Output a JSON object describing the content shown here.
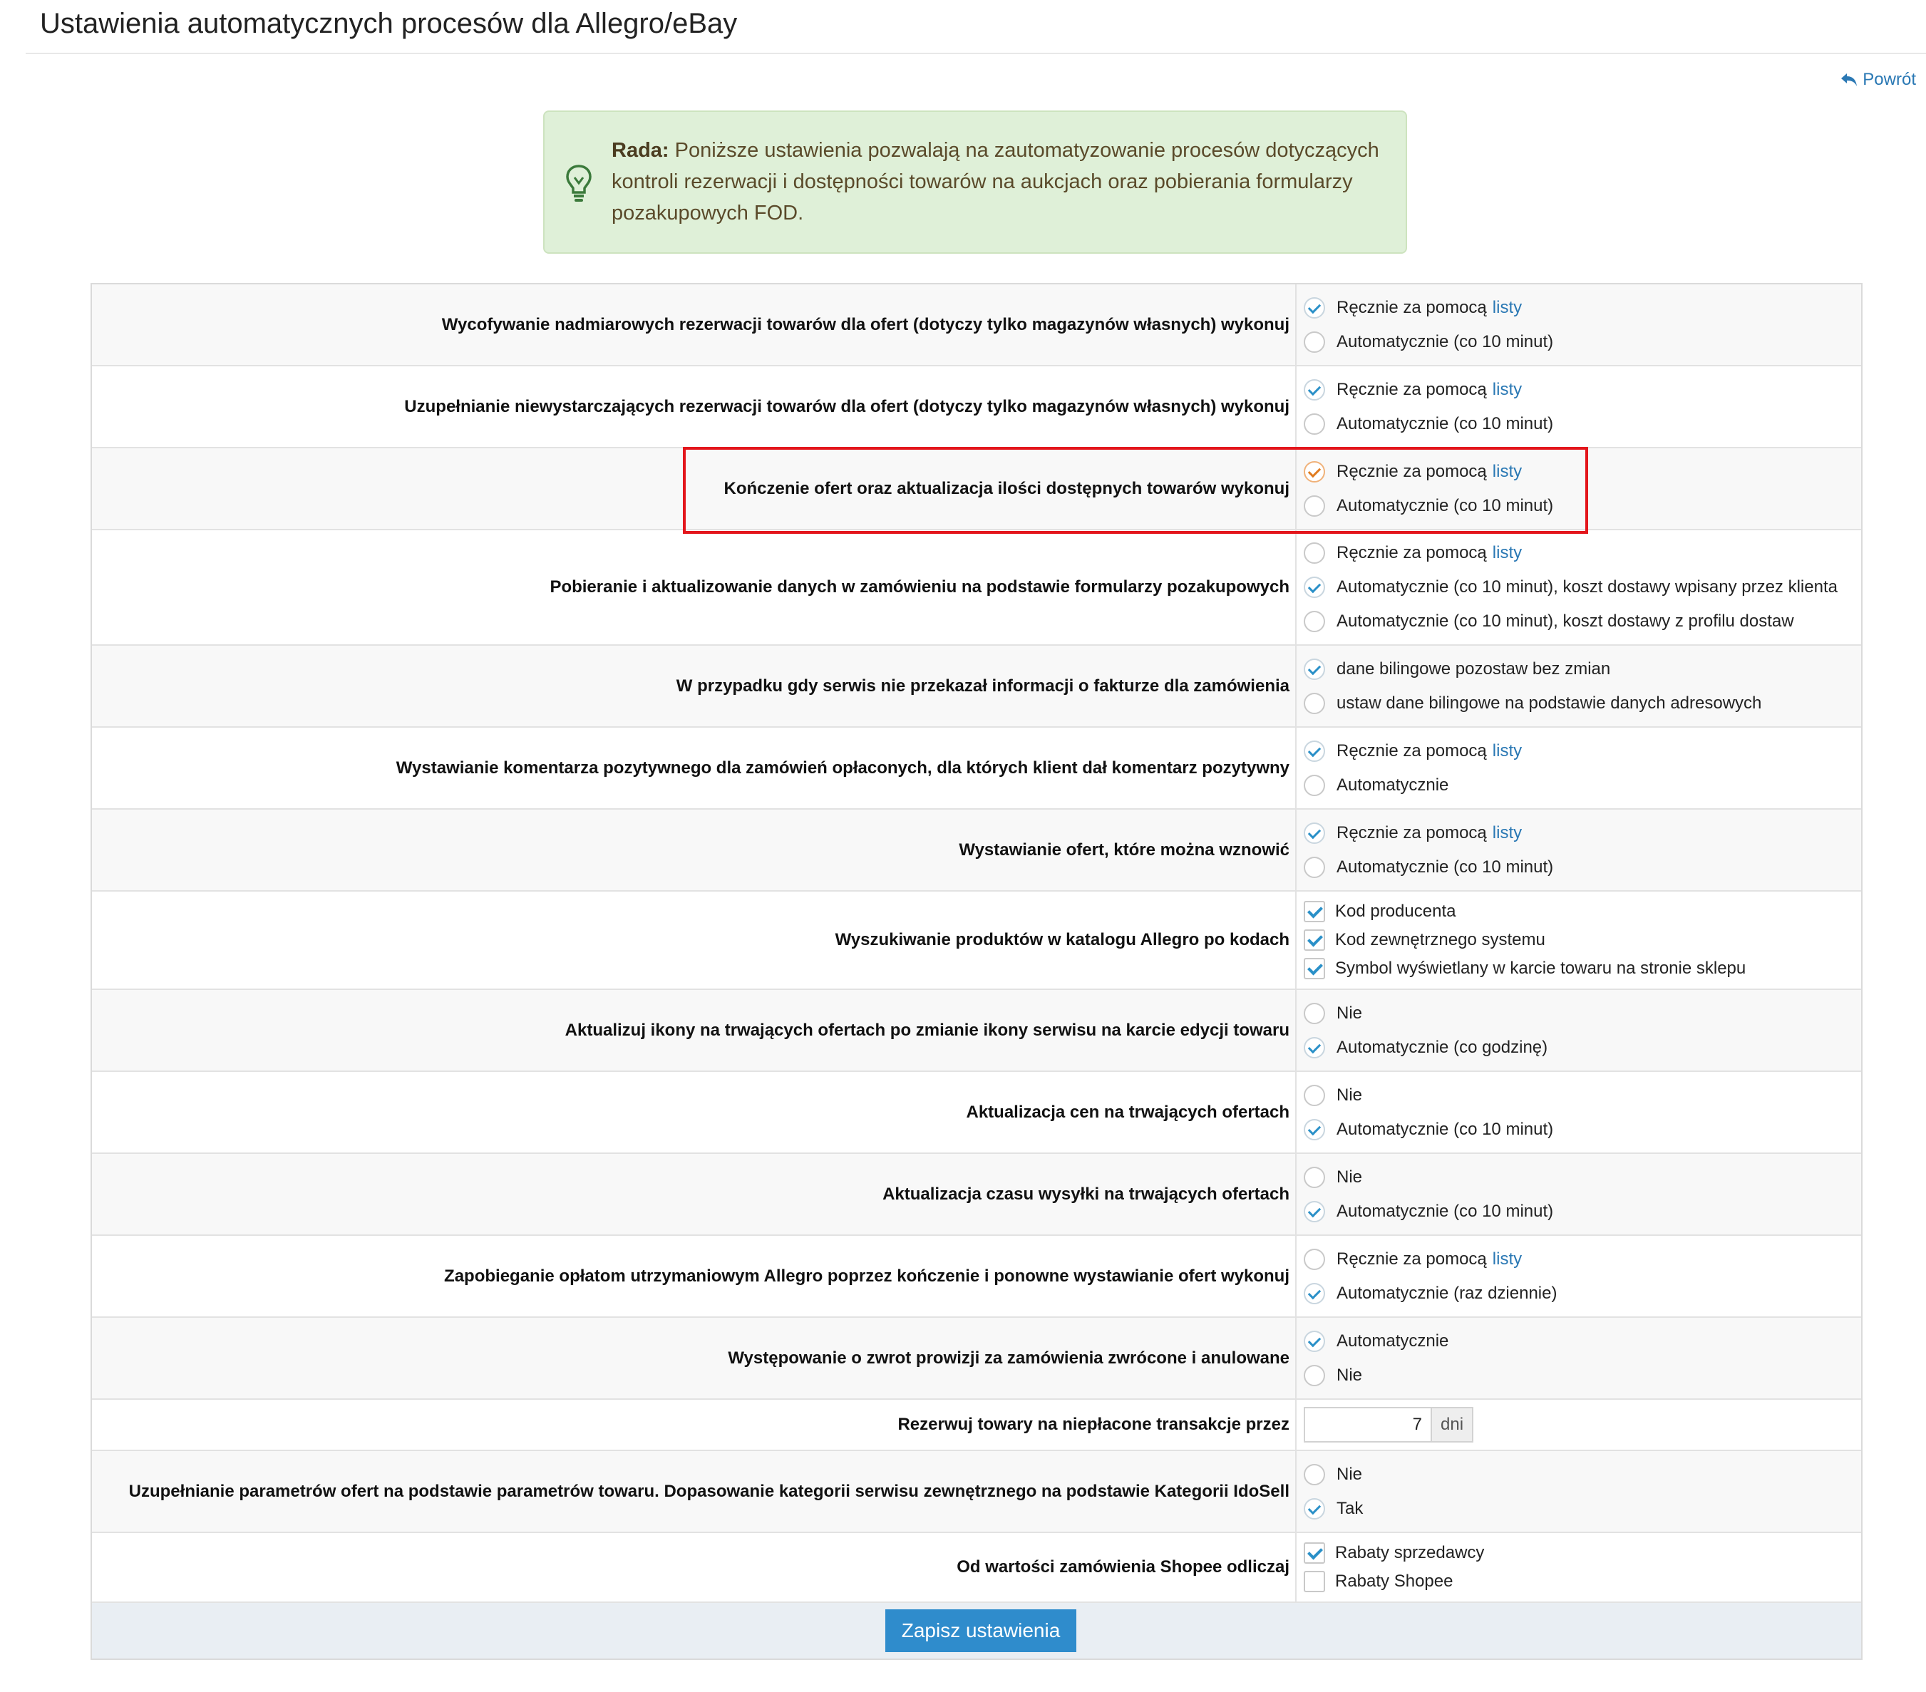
{
  "header": {
    "title": "Ustawienia automatycznych procesów dla Allegro/eBay",
    "back_label": "Powrót"
  },
  "tip": {
    "prefix": "Rada:",
    "text": " Poniższe ustawienia pozwalają na zautomatyzowanie procesów dotyczących kontroli rezerwacji i dostępności towarów na aukcjach oraz pobierania formularzy pozakupowych FOD."
  },
  "settings": [
    {
      "label": "Wycofywanie nadmiarowych rezerwacji towarów dla ofert (dotyczy tylko magazynów własnych) wykonuj",
      "options": [
        {
          "text": "Ręcznie za pomocą",
          "link": "listy",
          "checked": true
        },
        {
          "text": "Automatycznie (co 10 minut)",
          "checked": false
        }
      ]
    },
    {
      "label": "Uzupełnianie niewystarczających rezerwacji towarów dla ofert (dotyczy tylko magazynów własnych) wykonuj",
      "options": [
        {
          "text": "Ręcznie za pomocą",
          "link": "listy",
          "checked": true
        },
        {
          "text": "Automatycznie (co 10 minut)",
          "checked": false
        }
      ]
    },
    {
      "label": "Kończenie ofert oraz aktualizacja ilości dostępnych towarów wykonuj",
      "options": [
        {
          "text": "Ręcznie za pomocą",
          "link": "listy",
          "checked": true
        },
        {
          "text": "Automatycznie (co 10 minut)",
          "checked": false
        }
      ]
    },
    {
      "label": "Pobieranie i aktualizowanie danych w zamówieniu na podstawie formularzy pozakupowych",
      "options": [
        {
          "text": "Ręcznie za pomocą",
          "link": "listy",
          "checked": false
        },
        {
          "text": "Automatycznie (co 10 minut), koszt dostawy wpisany przez klienta",
          "checked": true
        },
        {
          "text": "Automatycznie (co 10 minut), koszt dostawy z profilu dostaw",
          "checked": false
        }
      ]
    },
    {
      "label": "W przypadku gdy serwis nie przekazał informacji o fakturze dla zamówienia",
      "options": [
        {
          "text": "dane bilingowe pozostaw bez zmian",
          "checked": true
        },
        {
          "text": "ustaw dane bilingowe na podstawie danych adresowych",
          "checked": false
        }
      ]
    },
    {
      "label": "Wystawianie komentarza pozytywnego dla zamówień opłaconych, dla których klient dał komentarz pozytywny",
      "options": [
        {
          "text": "Ręcznie za pomocą",
          "link": "listy",
          "checked": true
        },
        {
          "text": "Automatycznie",
          "checked": false
        }
      ]
    },
    {
      "label": "Wystawianie ofert, które można wznowić",
      "options": [
        {
          "text": "Ręcznie za pomocą",
          "link": "listy",
          "checked": true
        },
        {
          "text": "Automatycznie (co 10 minut)",
          "checked": false
        }
      ]
    },
    {
      "label": "Wyszukiwanie produktów w katalogu Allegro po kodach",
      "checkboxes": [
        {
          "text": "Kod producenta",
          "checked": true
        },
        {
          "text": "Kod zewnętrznego systemu",
          "checked": true
        },
        {
          "text": "Symbol wyświetlany w karcie towaru na stronie sklepu",
          "checked": true
        }
      ]
    },
    {
      "label": "Aktualizuj ikony na trwających ofertach po zmianie ikony serwisu na karcie edycji towaru",
      "options": [
        {
          "text": "Nie",
          "checked": false
        },
        {
          "text": "Automatycznie (co godzinę)",
          "checked": true
        }
      ]
    },
    {
      "label": "Aktualizacja cen na trwających ofertach",
      "options": [
        {
          "text": "Nie",
          "checked": false
        },
        {
          "text": "Automatycznie (co 10 minut)",
          "checked": true
        }
      ]
    },
    {
      "label": "Aktualizacja czasu wysyłki na trwających ofertach",
      "options": [
        {
          "text": "Nie",
          "checked": false
        },
        {
          "text": "Automatycznie (co 10 minut)",
          "checked": true
        }
      ]
    },
    {
      "label": "Zapobieganie opłatom utrzymaniowym Allegro poprzez kończenie i ponowne wystawianie ofert wykonuj",
      "options": [
        {
          "text": "Ręcznie za pomocą",
          "link": "listy",
          "checked": false
        },
        {
          "text": "Automatycznie (raz dziennie)",
          "checked": true
        }
      ]
    },
    {
      "label": "Występowanie o zwrot prowizji za zamówienia zwrócone i anulowane",
      "options": [
        {
          "text": "Automatycznie",
          "checked": true
        },
        {
          "text": "Nie",
          "checked": false
        }
      ]
    },
    {
      "label": "Rezerwuj towary na niepłacone transakcje przez",
      "input": {
        "value": "7",
        "unit": "dni"
      }
    },
    {
      "label": "Uzupełnianie parametrów ofert na podstawie parametrów towaru. Dopasowanie kategorii serwisu zewnętrznego na podstawie Kategorii IdoSell",
      "options": [
        {
          "text": "Nie",
          "checked": false
        },
        {
          "text": "Tak",
          "checked": true
        }
      ]
    },
    {
      "label": "Od wartości zamówienia Shopee odliczaj",
      "checkboxes": [
        {
          "text": "Rabaty sprzedawcy",
          "checked": true
        },
        {
          "text": "Rabaty Shopee",
          "checked": false
        }
      ]
    }
  ],
  "footer": {
    "save_label": "Zapisz ustawienia"
  },
  "colors": {
    "accent": "#2f8ccc",
    "link": "#2a78b4",
    "tip_bg": "#dff0d8",
    "highlight": "#e3161c"
  }
}
